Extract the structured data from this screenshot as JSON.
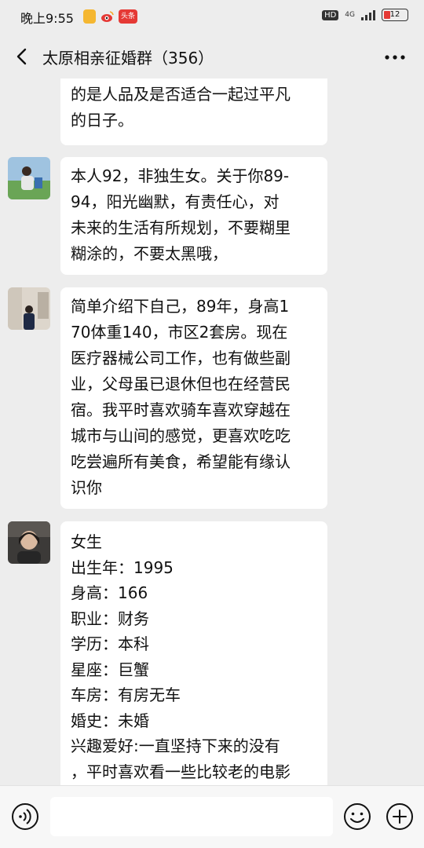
{
  "status_bar": {
    "time": "晚上9:55",
    "hd": "HD",
    "network": "4G",
    "battery": "12",
    "news_app_label": "头条"
  },
  "header": {
    "title": "太原相亲征婚群（356）"
  },
  "messages": [
    {
      "lines": [
        "的是人品及是否适合一起过平凡",
        "的日子。"
      ]
    },
    {
      "lines": [
        "本人92，非独生女。关于你89-",
        "94，阳光幽默，有责任心，对",
        "未来的生活有所规划，不要糊里",
        "糊涂的，不要太黑哦，"
      ]
    },
    {
      "lines": [
        "简单介绍下自己，89年，身高1",
        "70体重140，市区2套房。现在",
        "医疗器械公司工作，也有做些副",
        "业，父母虽已退休但也在经营民",
        "宿。我平时喜欢骑车喜欢穿越在",
        "城市与山间的感觉，更喜欢吃吃",
        "吃尝遍所有美食，希望能有缘认",
        "识你"
      ]
    },
    {
      "lines": [
        "女生",
        "出生年：1995",
        "身高：166",
        "职业：财务",
        "学历：本科",
        "星座：巨蟹",
        "车房：有房无车",
        "婚史：未婚",
        "兴趣爱好:一直坚持下来的没有",
        "，平时喜欢看一些比较老的电影"
      ]
    }
  ],
  "input_bar": {
    "placeholder": ""
  },
  "icons": {
    "back": "back-arrow-icon",
    "more": "more-dots-icon",
    "voice": "voice-icon",
    "emoji": "emoji-icon",
    "plus": "plus-icon"
  }
}
